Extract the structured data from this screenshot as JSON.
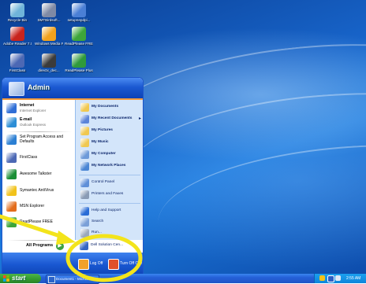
{
  "desktop": {
    "icons": [
      {
        "label": "Recycle Bin",
        "icon": "recycle-bin-icon",
        "color": "#6fb4d9"
      },
      {
        "label": "SMTBirdsoft...",
        "icon": "application-icon",
        "color": "#7f8aa5"
      },
      {
        "label": "setupnepdpi...",
        "icon": "setup-icon",
        "color": "#4a7fd6"
      },
      {
        "label": "Adobe Reader 7.0",
        "icon": "adobe-reader-icon",
        "color": "#c8241d"
      },
      {
        "label": "Windows Media Player",
        "icon": "media-player-icon",
        "color": "#f2a21c"
      },
      {
        "label": "ReadPlease FREE",
        "icon": "readplease-icon",
        "color": "#3da53a"
      },
      {
        "label": "FirstClass",
        "icon": "firstclass-icon",
        "color": "#4c68b4"
      },
      {
        "label": "directx_dec...",
        "icon": "directx-icon",
        "color": "#3b3b3b"
      },
      {
        "label": "ReadPlease Plus",
        "icon": "readplease-plus-icon",
        "color": "#2f9a3b"
      }
    ]
  },
  "start_menu": {
    "user": "Admin",
    "pinned": [
      {
        "title": "Internet",
        "subtitle": "Internet Explorer",
        "icon": "internet-explorer-icon",
        "color": "#2f6ed6"
      },
      {
        "title": "E-mail",
        "subtitle": "Outlook Express",
        "icon": "outlook-express-icon",
        "color": "#2c8ed6"
      }
    ],
    "recent": [
      {
        "title": "Set Program Access and Defaults",
        "icon": "program-access-icon",
        "color": "#2b7fd3"
      },
      {
        "title": "FirstClass",
        "icon": "firstclass-icon",
        "color": "#4c68b4"
      },
      {
        "title": "Awesome Talkster",
        "icon": "talkster-icon",
        "color": "#1b8f36"
      },
      {
        "title": "Symantec AntiVirus",
        "icon": "antivirus-icon",
        "color": "#f1c21b"
      },
      {
        "title": "MSN Explorer",
        "icon": "msn-explorer-icon",
        "color": "#e36d1c"
      },
      {
        "title": "ReadPlease FREE",
        "icon": "readplease-icon",
        "color": "#3da53a"
      }
    ],
    "all_programs": "All Programs",
    "places": [
      {
        "label": "My Documents",
        "icon": "my-documents-icon",
        "color": "#f0c850",
        "bold": true
      },
      {
        "label": "My Recent Documents",
        "icon": "recent-documents-icon",
        "color": "#5b84d9",
        "bold": true,
        "submenu": "▸"
      },
      {
        "label": "My Pictures",
        "icon": "my-pictures-icon",
        "color": "#f0c850",
        "bold": true
      },
      {
        "label": "My Music",
        "icon": "my-music-icon",
        "color": "#f0c850",
        "bold": true
      },
      {
        "label": "My Computer",
        "icon": "my-computer-icon",
        "color": "#6d9ad9",
        "bold": true
      },
      {
        "label": "My Network Places",
        "icon": "network-places-icon",
        "color": "#4b86d4",
        "bold": true
      }
    ],
    "system": [
      {
        "label": "Control Panel",
        "icon": "control-panel-icon",
        "color": "#5f8fd8"
      },
      {
        "label": "Printers and Faxes",
        "icon": "printers-icon",
        "color": "#8a9bb5"
      }
    ],
    "help": [
      {
        "label": "Help and Support",
        "icon": "help-icon",
        "color": "#2a6cd6"
      },
      {
        "label": "Search",
        "icon": "search-icon",
        "color": "#7ba0d8"
      },
      {
        "label": "Run...",
        "icon": "run-icon",
        "color": "#9aa8bd"
      }
    ],
    "extra": {
      "label": "Dell Solution Cen...",
      "icon": "dell-icon",
      "color": "#3567c2"
    },
    "log_off": "Log Off",
    "turn_off": "Turn Off Computer"
  },
  "taskbar": {
    "start": "start",
    "task": "Document1 - Microsof...",
    "clock": "2:55 AM"
  },
  "annotation": {
    "color": "#f3e41b"
  }
}
